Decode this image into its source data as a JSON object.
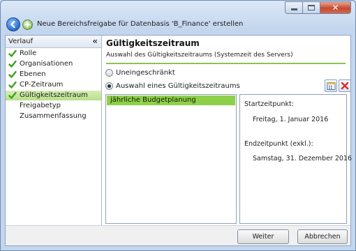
{
  "window": {
    "title": "Neue Bereichsfreigabe für Datenbasis 'B_Finance' erstellen"
  },
  "sidebar": {
    "header": "Verlauf",
    "collapse_glyph": "«",
    "items": [
      {
        "label": "Rolle",
        "completed": true
      },
      {
        "label": "Organisationen",
        "completed": true
      },
      {
        "label": "Ebenen",
        "completed": true
      },
      {
        "label": "CP-Zeitraum",
        "completed": true
      },
      {
        "label": "Gültigkeitszeitraum",
        "completed": true,
        "active": true
      },
      {
        "label": "Freigabetyp",
        "completed": false
      },
      {
        "label": "Zusammenfassung",
        "completed": false
      }
    ]
  },
  "main": {
    "title": "Gültigkeitszeitraum",
    "subtitle": "Auswahl des Gültigkeitszeitraums (Systemzeit des Servers)",
    "options": [
      {
        "label": "Uneingeschränkt",
        "selected": false
      },
      {
        "label": "Auswahl eines Gültigkeitszeitraums",
        "selected": true
      }
    ],
    "list_items": [
      "jährliche Budgetplanung"
    ],
    "details": {
      "start_label": "Startzeitpunkt:",
      "start_value": "Freitag, 1. Januar 2016",
      "end_label": "Endzeitpunkt (exkl.):",
      "end_value": "Samstag, 31. Dezember 2016"
    }
  },
  "footer": {
    "next_label": "Weiter",
    "cancel_label": "Abbrechen"
  },
  "colors": {
    "accent_green": "#8fd04a",
    "check_green": "#3f9f1f",
    "delete_red": "#d9332b"
  }
}
